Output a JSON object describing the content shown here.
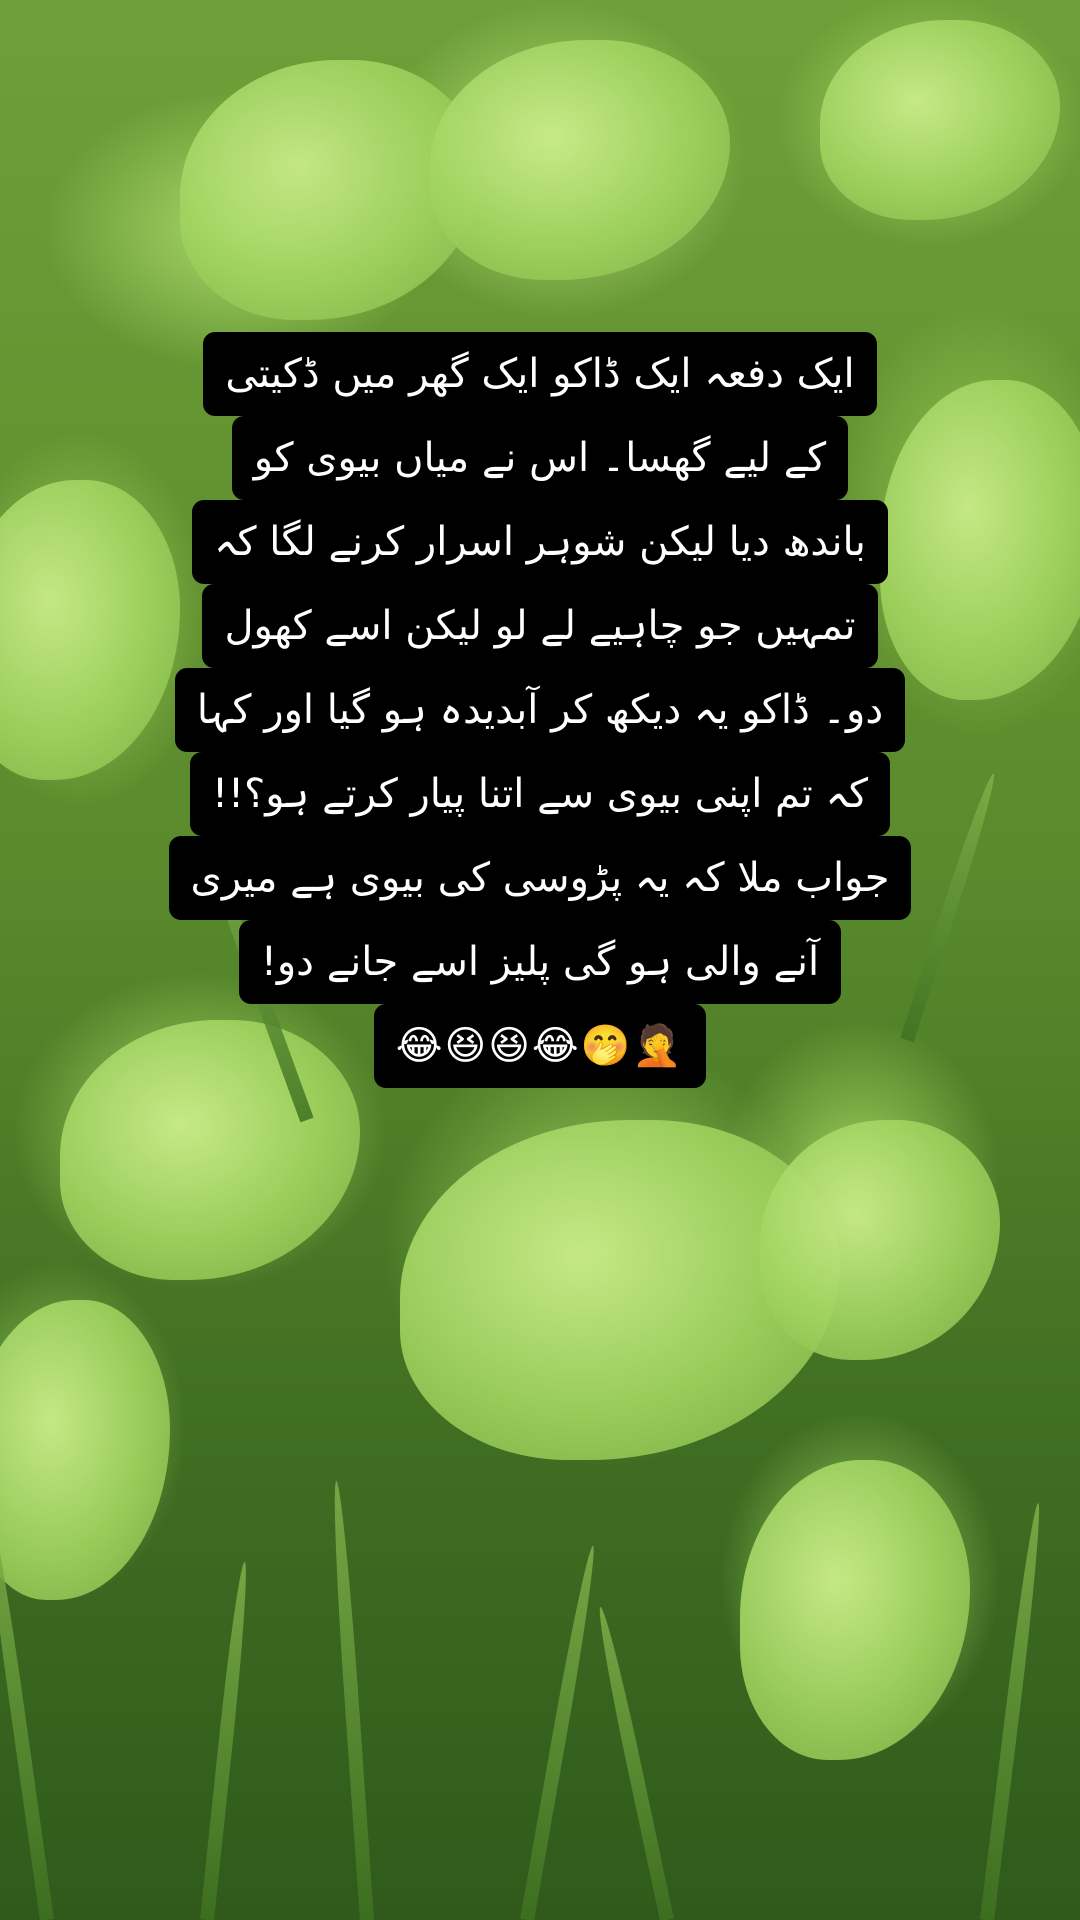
{
  "post": {
    "lines": [
      "ایک دفعہ ایک ڈاکو ایک گھر میں ڈکیتی",
      "کے لیے گھسا۔ اس نے میاں بیوی کو",
      "باندھ دیا لیکن شوہر اسرار کرنے لگا کہ",
      "تمہیں جو چاہیے لے لو لیکن اسے کھول",
      "دو۔ ڈاکو یہ دیکھ کر آبدیدہ ہو گیا اور کہا",
      "کہ تم اپنی بیوی سے اتنا پیار کرتے ہو؟!!",
      "جواب ملا کہ یہ پڑوسی کی بیوی ہے میری",
      "آنے والی ہو گی پلیز اسے جانے دو!",
      "😂😆😆😂🤭🤦"
    ]
  },
  "colors": {
    "caption_background": "#000000",
    "caption_text": "#ffffff"
  }
}
